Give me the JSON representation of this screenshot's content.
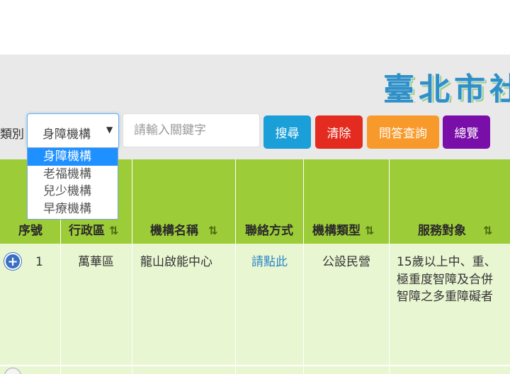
{
  "site": {
    "title": "臺北市社"
  },
  "filter": {
    "label": "類別",
    "selected": "身障機構",
    "keyword_placeholder": "請輸入關鍵字",
    "dropdown_options": [
      "身障機構",
      "老福機構",
      "兒少機構",
      "早療機構"
    ]
  },
  "buttons": {
    "search": "搜尋",
    "clear": "清除",
    "faq": "問答查詢",
    "browse": "總覽"
  },
  "table": {
    "headers": {
      "index": "序號",
      "district": "行政區",
      "name": "機構名稱",
      "contact": "聯絡方式",
      "type": "機構類型",
      "target": "服務對象"
    },
    "rows": [
      {
        "index": "1",
        "district": "萬華區",
        "name": "龍山啟能中心",
        "contact": "請點此",
        "type": "公設民營",
        "target_lines": [
          "15歲以上中、重、",
          "極重度智障及合併",
          "智障之多重障礙者"
        ]
      }
    ]
  },
  "colors": {
    "header_green": "#9dcc39",
    "row_green": "#e9f6d2",
    "search": "#1a9fd9",
    "clear": "#e42b1f",
    "faq": "#f89a2b",
    "browse": "#7a0ea9"
  },
  "icons": {
    "expand": "plus-circle-icon",
    "sort": "sort-arrows-icon"
  }
}
